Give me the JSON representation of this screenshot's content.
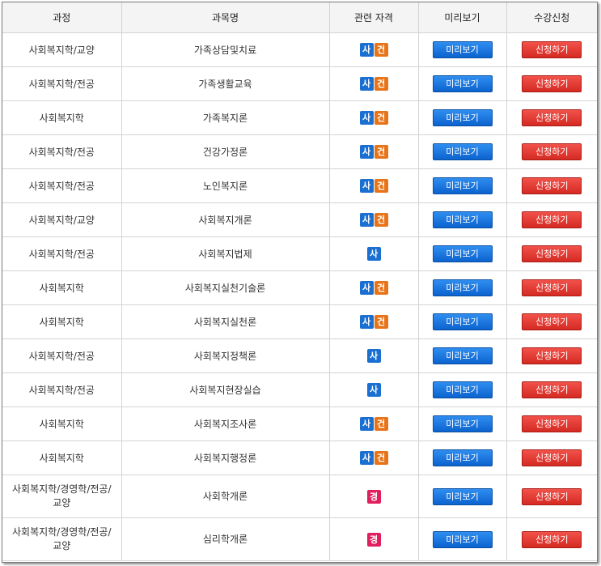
{
  "headers": [
    "과정",
    "과목명",
    "관련 자격",
    "미리보기",
    "수강신청"
  ],
  "preview_label": "미리보기",
  "apply_label": "신청하기",
  "badge_text": {
    "sa": "사",
    "geon": "건",
    "gyeong": "경"
  },
  "rows": [
    {
      "course": "사회복지학/교양",
      "subject": "가족상담및치료",
      "badges": [
        "sa",
        "geon"
      ]
    },
    {
      "course": "사회복지학/전공",
      "subject": "가족생활교육",
      "badges": [
        "sa",
        "geon"
      ]
    },
    {
      "course": "사회복지학",
      "subject": "가족복지론",
      "badges": [
        "sa",
        "geon"
      ]
    },
    {
      "course": "사회복지학/전공",
      "subject": "건강가정론",
      "badges": [
        "sa",
        "geon"
      ]
    },
    {
      "course": "사회복지학/전공",
      "subject": "노인복지론",
      "badges": [
        "sa",
        "geon"
      ]
    },
    {
      "course": "사회복지학/교양",
      "subject": "사회복지개론",
      "badges": [
        "sa",
        "geon"
      ]
    },
    {
      "course": "사회복지학/전공",
      "subject": "사회복지법제",
      "badges": [
        "sa"
      ]
    },
    {
      "course": "사회복지학",
      "subject": "사회복지실천기술론",
      "badges": [
        "sa",
        "geon"
      ]
    },
    {
      "course": "사회복지학",
      "subject": "사회복지실천론",
      "badges": [
        "sa",
        "geon"
      ]
    },
    {
      "course": "사회복지학/전공",
      "subject": "사회복지정책론",
      "badges": [
        "sa"
      ]
    },
    {
      "course": "사회복지학/전공",
      "subject": "사회복지현장실습",
      "badges": [
        "sa"
      ]
    },
    {
      "course": "사회복지학",
      "subject": "사회복지조사론",
      "badges": [
        "sa",
        "geon"
      ]
    },
    {
      "course": "사회복지학",
      "subject": "사회복지행정론",
      "badges": [
        "sa",
        "geon"
      ]
    },
    {
      "course": "사회복지학/경영학/전공/\n교양",
      "subject": "사회학개론",
      "badges": [
        "gyeong"
      ]
    },
    {
      "course": "사회복지학/경영학/전공/\n교양",
      "subject": "심리학개론",
      "badges": [
        "gyeong"
      ]
    }
  ],
  "colors": {
    "sa": "#1a6fd1",
    "geon": "#e8741a",
    "gyeong": "#e0205e",
    "preview": "#0c63cf",
    "apply": "#d42a22"
  }
}
